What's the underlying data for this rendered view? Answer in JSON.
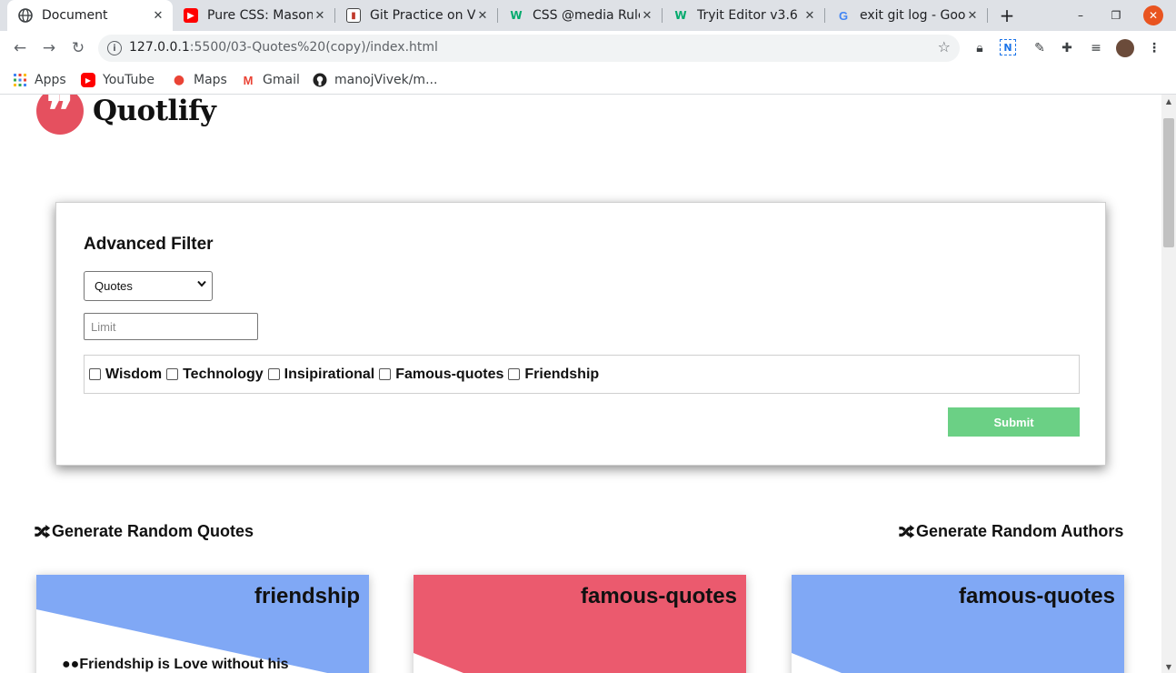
{
  "browser": {
    "tabs": [
      {
        "title": "Document",
        "icon": "globe-icon",
        "active": true
      },
      {
        "title": "Pure CSS: Masonry",
        "icon": "youtube-icon",
        "active": false
      },
      {
        "title": "Git Practice on VS Code",
        "icon": "trello-icon",
        "active": false
      },
      {
        "title": "CSS @media Rule",
        "icon": "w3schools-icon",
        "active": false
      },
      {
        "title": "Tryit Editor v3.6",
        "icon": "w3schools-icon",
        "active": false
      },
      {
        "title": "exit git log - Google",
        "icon": "google-icon",
        "active": false
      }
    ],
    "url_host": "127.0.0.1",
    "url_path": ":5500/03-Quotes%20(copy)/index.html",
    "bookmarks": [
      {
        "label": "Apps",
        "icon": "apps-grid-icon"
      },
      {
        "label": "YouTube",
        "icon": "youtube-icon"
      },
      {
        "label": "Maps",
        "icon": "maps-pin-icon"
      },
      {
        "label": "Gmail",
        "icon": "gmail-icon"
      },
      {
        "label": "manojVivek/m...",
        "icon": "github-icon"
      }
    ]
  },
  "page": {
    "logo_name": "Quotlify",
    "filter": {
      "title": "Advanced Filter",
      "select_value": "Quotes",
      "limit_placeholder": "Limit",
      "tags": [
        "Wisdom",
        "Technology",
        "Insipirational",
        "Famous-quotes",
        "Friendship"
      ],
      "submit_label": "Submit"
    },
    "generate_quotes_label": "Generate Random Quotes",
    "generate_authors_label": "Generate Random Authors",
    "cards": [
      {
        "category": "friendship",
        "text": "Friendship is Love without his",
        "color": "#80a8f5"
      },
      {
        "category": "famous-quotes",
        "text": "",
        "color": "#eb5a6e"
      },
      {
        "category": "famous-quotes",
        "text": "",
        "color": "#80a8f5"
      }
    ]
  },
  "colors": {
    "logo_red": "#e5505f",
    "submit_green": "#6bd085",
    "card_blue": "#80a8f5",
    "card_red": "#eb5a6e",
    "window_close": "#e95420"
  }
}
